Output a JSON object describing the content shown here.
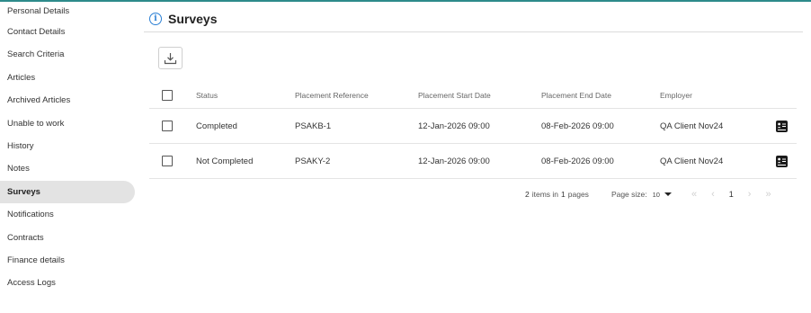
{
  "sidebar": {
    "items": [
      {
        "label": "Personal Details"
      },
      {
        "label": "Contact Details"
      },
      {
        "label": "Search Criteria"
      },
      {
        "label": "Articles"
      },
      {
        "label": "Archived Articles"
      },
      {
        "label": "Unable to work"
      },
      {
        "label": "History"
      },
      {
        "label": "Notes"
      },
      {
        "label": "Surveys",
        "active": true
      },
      {
        "label": "Notifications"
      },
      {
        "label": "Contracts"
      },
      {
        "label": "Finance details"
      },
      {
        "label": "Access Logs"
      }
    ]
  },
  "header": {
    "title": "Surveys",
    "icon": "info-icon"
  },
  "toolbar": {
    "download_icon": "download-icon"
  },
  "grid": {
    "columns": [
      "Status",
      "Placement Reference",
      "Placement Start Date",
      "Placement End Date",
      "Employer"
    ],
    "rows": [
      {
        "status": "Completed",
        "reference": "PSAKB-1",
        "start": "12-Jan-2026 09:00",
        "end": "08-Feb-2026 09:00",
        "employer": "QA Client Nov24",
        "action_icon": "survey-details-icon"
      },
      {
        "status": "Not Completed",
        "reference": "PSAKY-2",
        "start": "12-Jan-2026 09:00",
        "end": "08-Feb-2026 09:00",
        "employer": "QA Client Nov24",
        "action_icon": "survey-details-icon"
      }
    ]
  },
  "pager": {
    "total_items": "2",
    "items_in_text": "items in",
    "total_pages": "1",
    "pages_text": "pages",
    "page_size_label": "Page size:",
    "page_size_value": "10",
    "current_page": "1"
  },
  "colors": {
    "accent": "#2a7fd4",
    "top_line": "#2e8b8b",
    "active_bg": "#e3e3e3"
  }
}
